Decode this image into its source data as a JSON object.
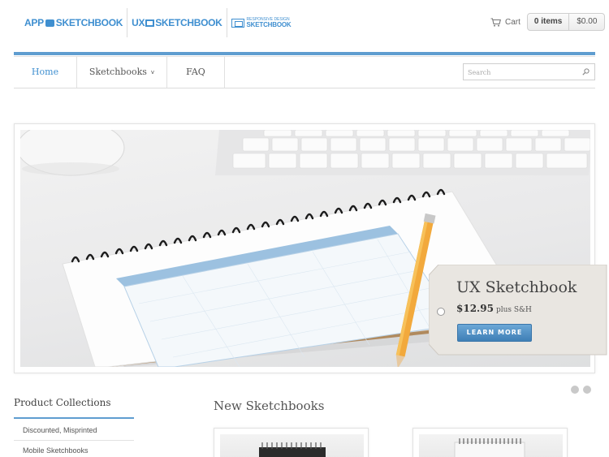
{
  "brand": {
    "logos": [
      {
        "prefix": "APP",
        "suffix": "SKETCHBOOK"
      },
      {
        "prefix": "UX",
        "suffix": "SKETCHBOOK"
      },
      {
        "small": "RESPONSIVE DESIGN",
        "big": "SKETCHBOOK"
      }
    ]
  },
  "cart": {
    "label": "Cart",
    "items": "0 items",
    "total": "$0.00"
  },
  "nav": {
    "items": [
      {
        "label": "Home"
      },
      {
        "label": "Sketchbooks",
        "chevron": "v"
      },
      {
        "label": "FAQ"
      }
    ],
    "search_placeholder": "Search"
  },
  "hero": {
    "title": "UX Sketchbook",
    "price": "$12.95",
    "price_note": "plus S&H",
    "button": "LEARN MORE"
  },
  "sidebar": {
    "title": "Product Collections",
    "items": [
      "Discounted, Misprinted",
      "Mobile Sketchbooks"
    ]
  },
  "main": {
    "title": "New Sketchbooks"
  },
  "colors": {
    "accent": "#5f9dd0",
    "link": "#3f8fd0",
    "button": "#4a8bc2"
  },
  "icons": {
    "cart": "cart-icon",
    "search": "search-icon"
  }
}
